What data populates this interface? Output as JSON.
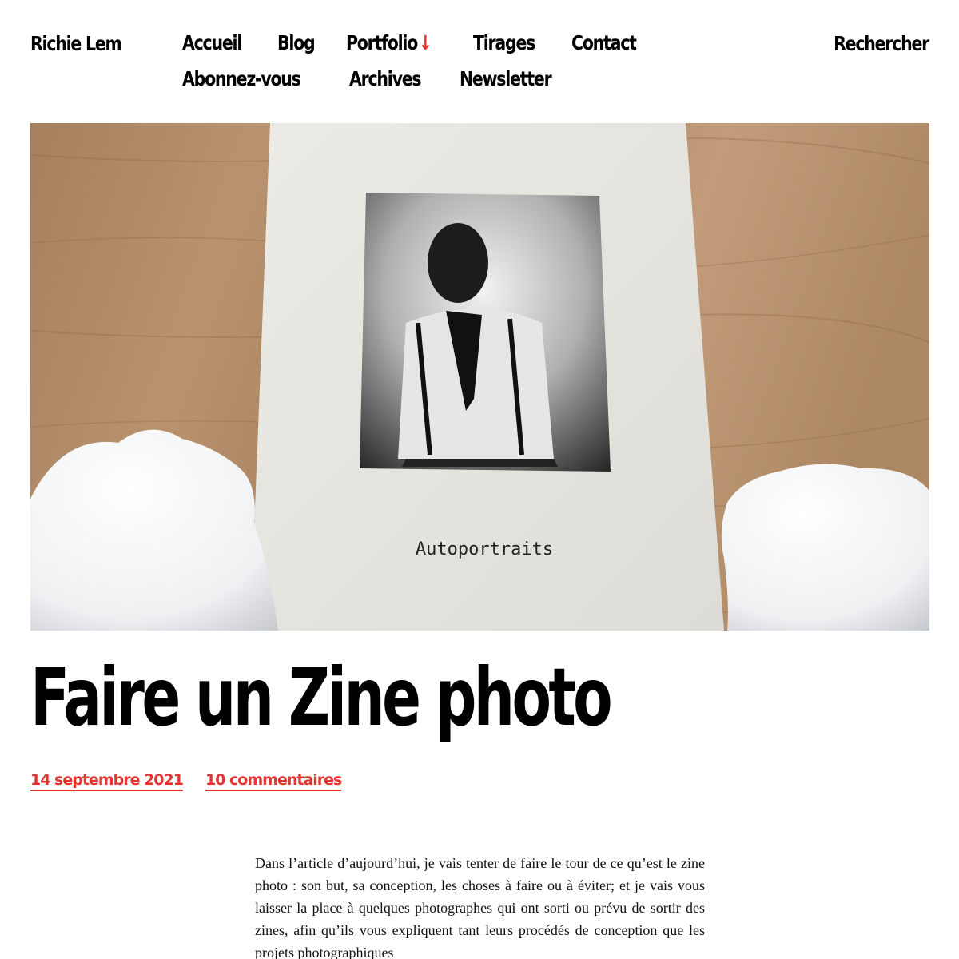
{
  "site": {
    "title": "Richie Lem"
  },
  "nav": {
    "items": [
      {
        "label": "Accueil"
      },
      {
        "label": "Blog"
      },
      {
        "label": "Portfolio",
        "has_submenu": true,
        "icon": "arrow-down-icon"
      },
      {
        "label": "Tirages"
      },
      {
        "label": "Contact"
      },
      {
        "label": "Abonnez-vous"
      },
      {
        "label": "Archives"
      },
      {
        "label": "Newsletter"
      }
    ],
    "submenu_icon": "↓",
    "accent_color": "#e3342f"
  },
  "search": {
    "label": "Rechercher"
  },
  "featured_image": {
    "cover_text": "Autoportraits"
  },
  "post": {
    "title": "Faire un Zine photo",
    "date": "14 septembre 2021",
    "comments": "10 commentaires",
    "intro": "Dans l’article d’aujourd’hui, je vais tenter de faire le tour de ce qu’est le zine photo : son but, sa conception, les choses à faire ou à éviter; et je vais vous laisser la place à quelques photographes qui ont sorti ou prévu de sortir des zines, afin qu’ils vous expliquent tant leurs procédés de conception que les projets photographiques"
  },
  "colors": {
    "accent": "#e3342f",
    "text": "#000000",
    "background": "#ffffff"
  }
}
